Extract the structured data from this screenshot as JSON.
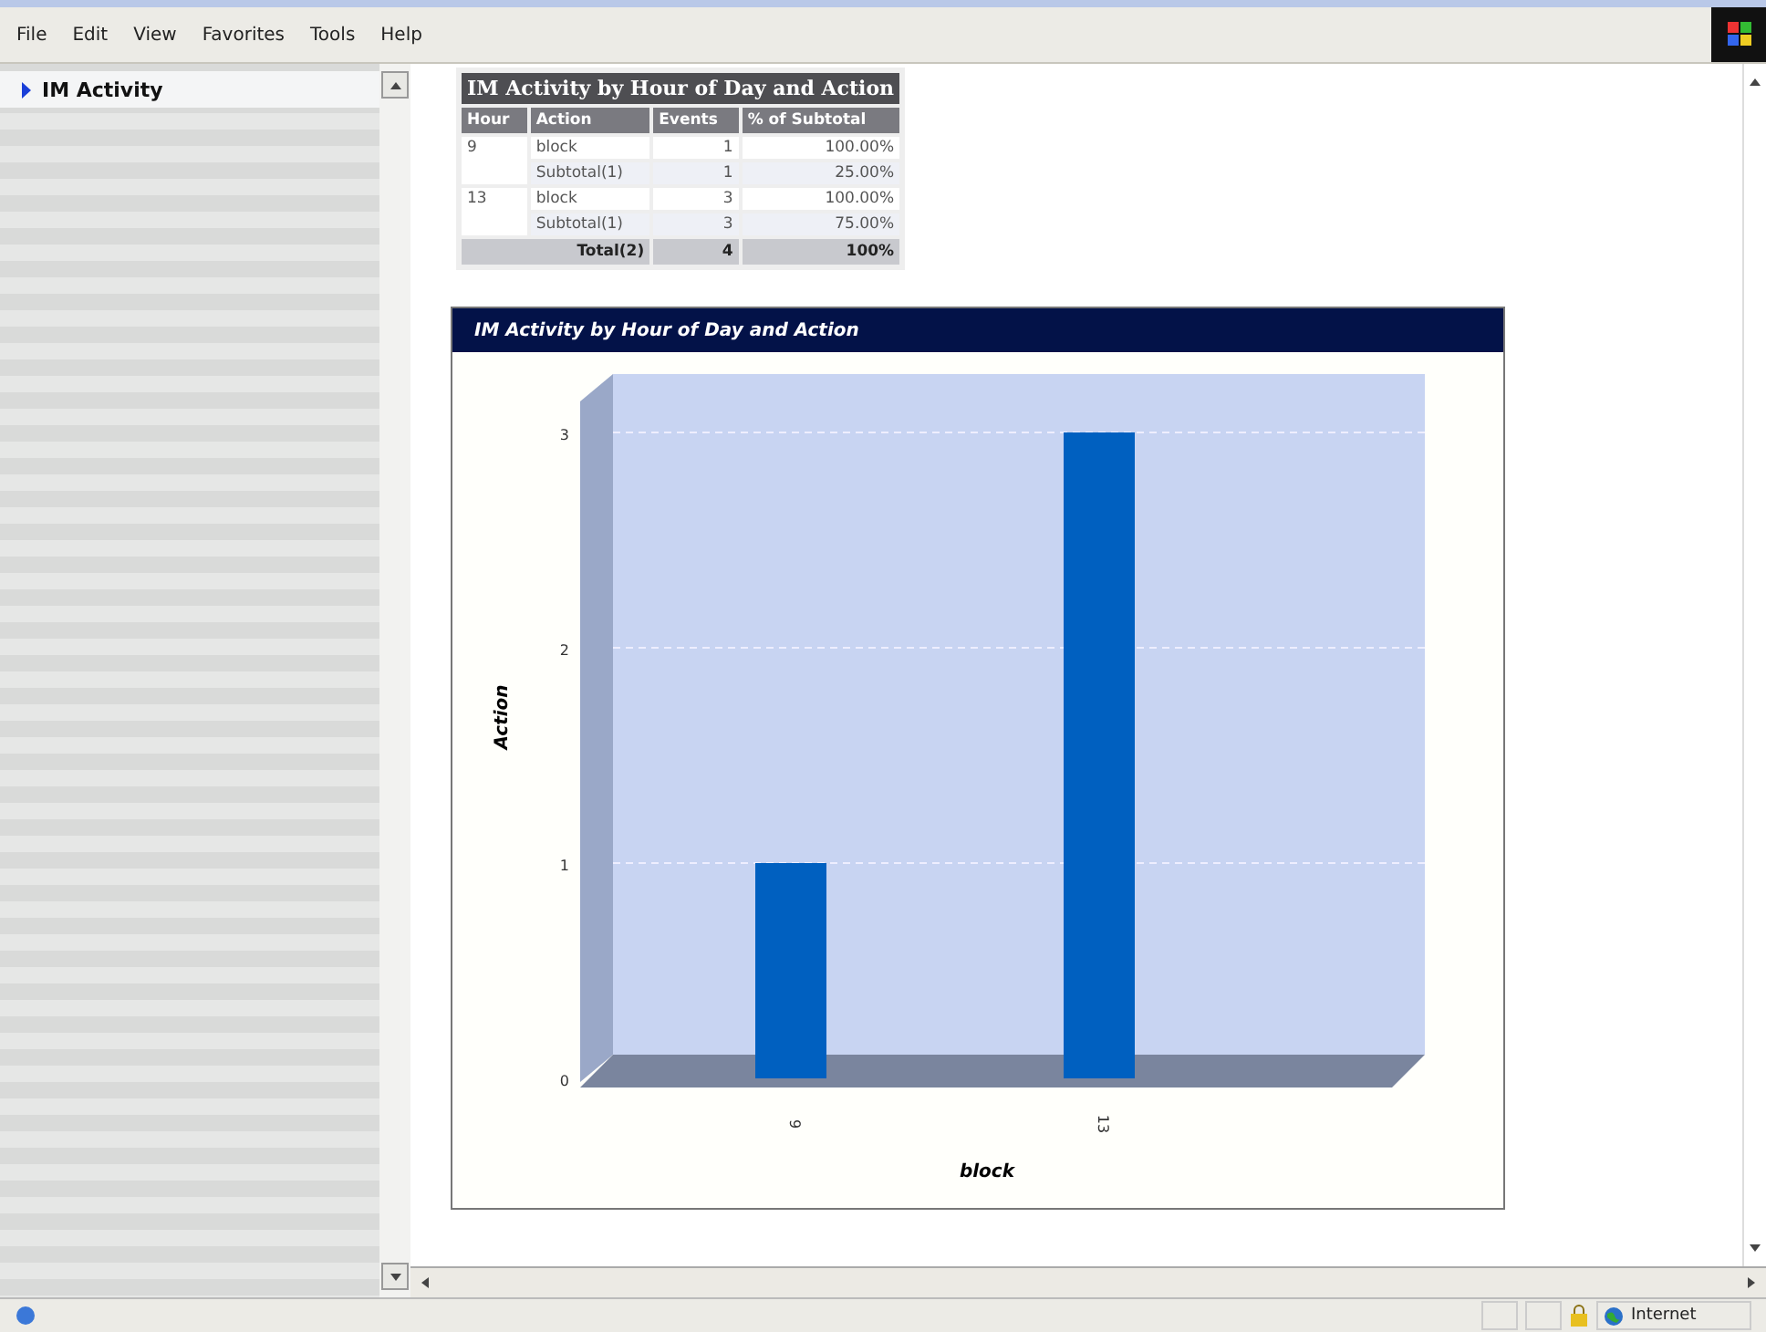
{
  "menu": [
    "File",
    "Edit",
    "View",
    "Favorites",
    "Tools",
    "Help"
  ],
  "sidebar": {
    "items": [
      {
        "label": "IM Activity",
        "selected": true
      }
    ]
  },
  "table": {
    "title": "IM Activity by Hour of Day and Action",
    "columns": [
      "Hour",
      "Action",
      "Events",
      "% of Subtotal"
    ],
    "groups": [
      {
        "hour": "9",
        "rows": [
          {
            "kind": "detail",
            "action": "block",
            "events": "1",
            "percent": "100.00%"
          },
          {
            "kind": "subtotal",
            "action": "Subtotal(1)",
            "events": "1",
            "percent": "25.00%"
          }
        ]
      },
      {
        "hour": "13",
        "rows": [
          {
            "kind": "detail",
            "action": "block",
            "events": "3",
            "percent": "100.00%"
          },
          {
            "kind": "subtotal",
            "action": "Subtotal(1)",
            "events": "3",
            "percent": "75.00%"
          }
        ]
      }
    ],
    "total": {
      "label": "Total(2)",
      "events": "4",
      "percent": "100%"
    }
  },
  "chart": {
    "chart_data": {
      "type": "bar",
      "title": "IM Activity by Hour of Day and Action",
      "xlabel": "block",
      "ylabel": "Action",
      "categories": [
        "9",
        "13"
      ],
      "values": [
        1,
        3
      ],
      "ylim": [
        0,
        3
      ],
      "yticks": [
        0,
        1,
        2,
        3
      ]
    }
  },
  "status_bar": {
    "zone": "Internet"
  }
}
